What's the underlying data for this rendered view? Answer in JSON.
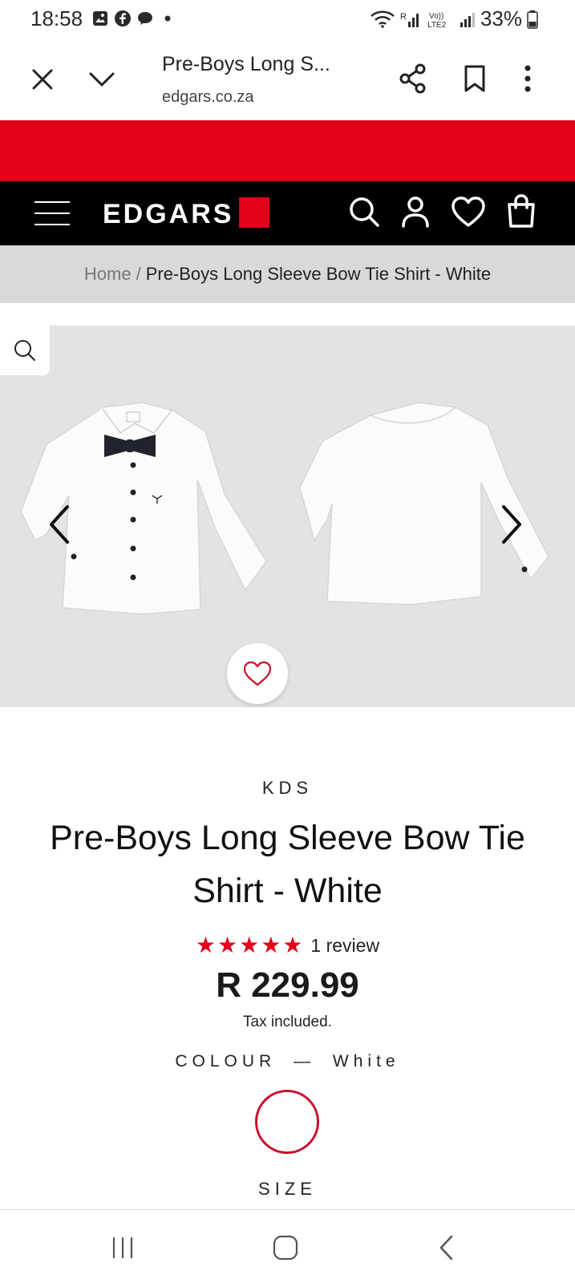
{
  "status_bar": {
    "time": "18:58",
    "battery": "33%",
    "left_icons": [
      "gallery-icon",
      "facebook-icon",
      "chat-icon",
      "dot-icon"
    ],
    "right_icons": [
      "wifi-icon",
      "signal-icon",
      "volte-icon",
      "signal-icon",
      "battery-icon"
    ]
  },
  "browser": {
    "page_title": "Pre-Boys Long S...",
    "domain": "edgars.co.za",
    "icons": [
      "close-icon",
      "chevron-down-icon",
      "share-icon",
      "bookmark-icon",
      "more-vert-icon"
    ]
  },
  "header": {
    "logo": "EDGARS",
    "brand_color": "#e2001a",
    "icons": [
      "menu-icon",
      "search-icon",
      "account-icon",
      "heart-icon",
      "bag-icon"
    ]
  },
  "breadcrumb": {
    "home": "Home",
    "separator": "/",
    "current": "Pre-Boys Long Sleeve Bow Tie Shirt - White"
  },
  "gallery": {
    "icons": [
      "zoom-icon",
      "chevron-left-icon",
      "chevron-right-icon",
      "heart-icon"
    ]
  },
  "product": {
    "brand": "KDS",
    "title": "Pre-Boys Long Sleeve Bow Tie Shirt - White",
    "stars": "★★★★★",
    "rating": 5,
    "review_count": "1 review",
    "price": "R 229.99",
    "tax_note": "Tax included.",
    "colour_label": "COLOUR",
    "colour_separator": "—",
    "colour_value": "White",
    "swatch_border_color": "#c8102e",
    "size_label": "SIZE"
  },
  "nav": {
    "icons": [
      "recents-icon",
      "home-icon",
      "back-icon"
    ]
  }
}
